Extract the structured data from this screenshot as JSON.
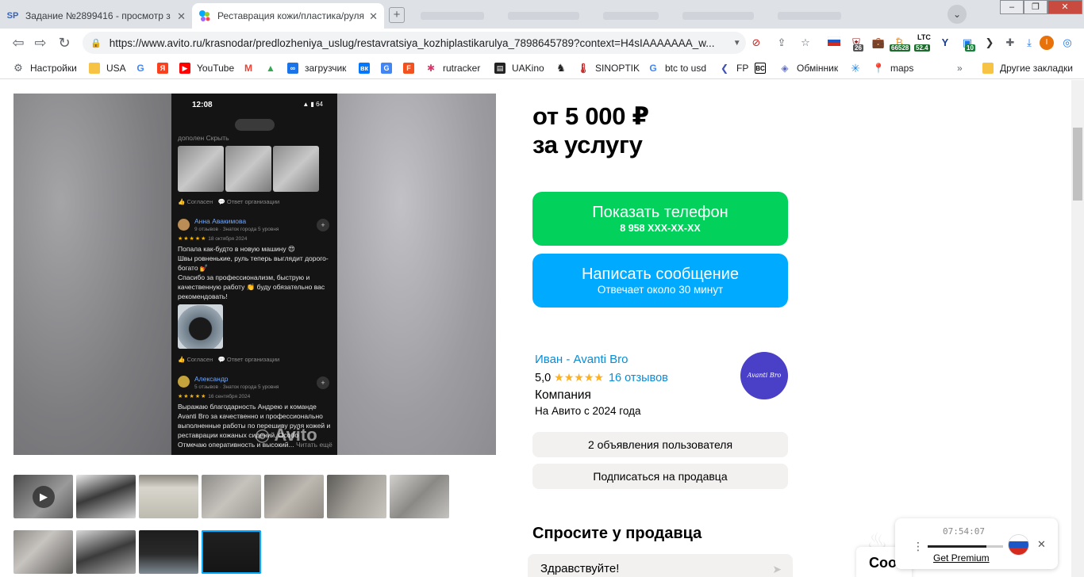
{
  "browser": {
    "tabs": [
      {
        "favicon": "SP",
        "title": "Задание №2899416 - просмотр з"
      },
      {
        "favicon": "avito-logo-icon",
        "title": "Реставрация кожи/пластика/руля"
      }
    ],
    "url": "https://www.avito.ru/krasnodar/predlozheniya_uslug/restavratsiya_kozhiplastikarulya_7898645789?context=H4sIAAAAAAA_w...",
    "extensions": {
      "badge1": "26",
      "badge2": "66528",
      "ltc_label": "LTC",
      "ltc_value": "52.4",
      "badge3": "10",
      "profile": "I"
    },
    "bookmarks": [
      "Настройки",
      "USA",
      "YouTube",
      "загрузчик",
      "rutracker",
      "UAKino",
      "SINOPTIK",
      "btc to usd",
      "FP",
      "Обмінник",
      "maps"
    ],
    "other_bookmarks": "Другие закладки"
  },
  "gallery": {
    "watermark": "Avito",
    "phone": {
      "time": "12:08",
      "battery": "64",
      "top_text": "дополен",
      "top_text_link": "Скрыть",
      "agree": "Согласен",
      "org_reply": "Ответ организации",
      "review1": {
        "name": "Анна Авакимова",
        "meta": "9 отзывов · Знаток города 5 уровня",
        "date": "18 октября 2024",
        "text1": "Попала как-будто в новую машину 😍",
        "text2": "Швы ровненькие, руль теперь выглядит дорого-",
        "text3": "богато 💅",
        "text4": "Спасибо за профессионализм, быструю и",
        "text5": "качественную работу 👏 буду обязательно вас",
        "text6": "рекомендовать!"
      },
      "review2": {
        "name": "Александр",
        "meta": "5 отзывов · Знаток города 5 уровня",
        "date": "16 сентября 2024",
        "text1": "Выражаю благодарность Андрею и команде",
        "text2": "Avanti Bro за качественно и профессионально",
        "text3": "выполненные работы по перешиву руля кожей и",
        "text4": "реставрации кожаных сидений. Особо",
        "text5": "Отмечаю оперативность и высокий...",
        "read_more": "Читать ещё"
      }
    }
  },
  "price": {
    "line1": "от 5 000 ₽",
    "line2": "за услугу"
  },
  "actions": {
    "show_phone": "Показать телефон",
    "phone_mask": "8 958 XXX-XX-XX",
    "message": "Написать сообщение",
    "message_sub": "Отвечает около 30 минут"
  },
  "seller": {
    "name": "Иван - Avanti Bro",
    "rating": "5,0",
    "stars": "★★★★★",
    "reviews": "16 отзывов",
    "type": "Компания",
    "since": "На Авито с 2024 года",
    "logo_text": "Avanti Bro",
    "ads_button": "2 объявления пользователя",
    "subscribe_button": "Подписаться на продавца"
  },
  "ask": {
    "title": "Спросите у продавца",
    "input_value": "Здравствуйте!"
  },
  "chat_fab": "Соо",
  "recorder": {
    "time": "07:54:07",
    "progress": 0.78,
    "premium": "Get Premium"
  },
  "colors": {
    "green": "#02d15c",
    "blue": "#00aaff",
    "link": "#0a8cd7",
    "star": "#ffb021"
  }
}
